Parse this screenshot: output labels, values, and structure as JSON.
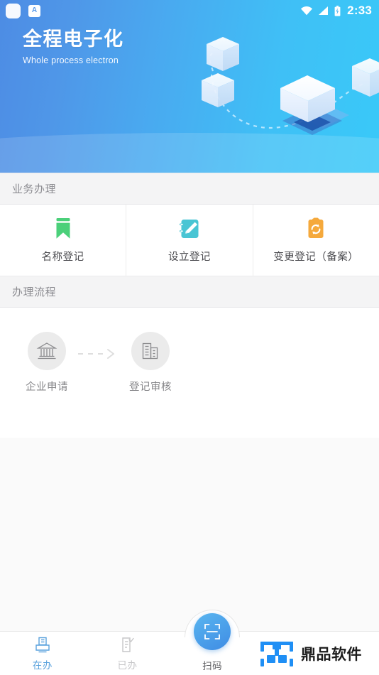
{
  "statusbar": {
    "app_icon_name": "app-square-icon",
    "a_badge": "A",
    "wifi_icon": "wifi-icon",
    "signal_icon": "cellular-signal-icon",
    "battery_icon": "battery-charging-icon",
    "time": "2:33"
  },
  "banner": {
    "title": "全程电子化",
    "subtitle": "Whole process electron",
    "gradient_start": "#4d8ce4",
    "gradient_end": "#39c9f8"
  },
  "sections": {
    "services": {
      "header": "业务办理",
      "items": [
        {
          "label": "名称登记",
          "icon": "bookmark-icon",
          "color": "#4bd07a"
        },
        {
          "label": "设立登记",
          "icon": "notebook-pencil-icon",
          "color": "#49c5d4"
        },
        {
          "label": "变更登记（备案）",
          "icon": "clipboard-refresh-icon",
          "color": "#f5a93c"
        }
      ]
    },
    "flow": {
      "header": "办理流程",
      "steps": [
        {
          "label": "企业申请",
          "icon": "bank-building-icon"
        },
        {
          "label": "登记审核",
          "icon": "office-building-icon"
        }
      ],
      "arrow_icon": "dashed-arrow-right-icon"
    }
  },
  "bottom_nav": {
    "items": [
      {
        "label": "在办",
        "icon": "printer-doc-icon",
        "state": "active",
        "color": "#5aa2dd"
      },
      {
        "label": "已办",
        "icon": "doc-check-icon",
        "state": "inactive",
        "color": "#c6c6c8"
      }
    ],
    "scan": {
      "label": "扫码",
      "icon": "scan-frame-icon",
      "color": "#3f8ce4"
    },
    "brand": {
      "logo_icon": "dingpin-logo-icon",
      "text": "鼎品软件",
      "color": "#1f8ff5"
    }
  }
}
